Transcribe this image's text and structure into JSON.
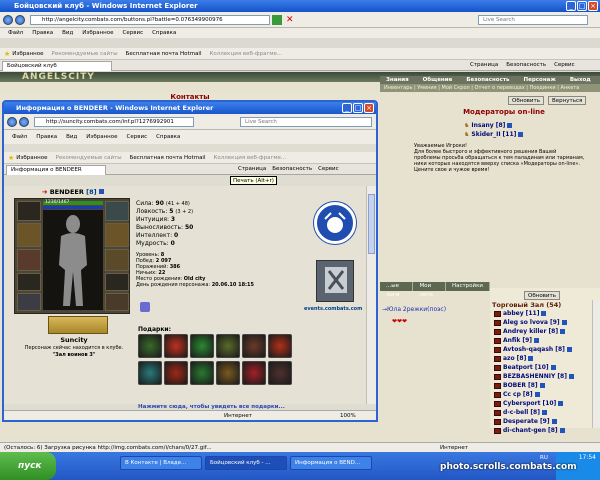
{
  "main_window": {
    "title": "Бойцовский клуб - Windows Internet Explorer",
    "url": "http://angelcity.combats.com/buttons.pl?battle=0.076349900976",
    "search_placeholder": "Live Search"
  },
  "menu": [
    "Файл",
    "Правка",
    "Вид",
    "Избранное",
    "Сервис",
    "Справка"
  ],
  "favorites": {
    "label": "Избранное",
    "items": [
      "Рекомендуемые сайты",
      "Бесплатная почта Hotmail",
      "Коллекция веб-фрагме..."
    ]
  },
  "tab": {
    "label": "Бойцовский клуб"
  },
  "tab_tools": [
    "Страница",
    "Безопасность",
    "Сервис"
  ],
  "game": {
    "banner": "ANGELSCITY",
    "nav": [
      "Знания",
      "Общение",
      "Безопасность",
      "Персонаж",
      "Выход"
    ],
    "subnav": "Инвентарь | Умения | Мой Скрол | Отчет о переводах | Поединки | Анкета",
    "contacts_title": "Контакты",
    "refresh_btn": "Обновить",
    "back_btn": "Вернуться",
    "moderators": {
      "title": "Модераторы on-line",
      "list": [
        {
          "name": "Insany",
          "level": "[8]"
        },
        {
          "name": "Skider_II",
          "level": "[11]"
        }
      ],
      "text": [
        "Уважаемые Игроки!",
        "Для более быстрого и эффективного решения Вашей",
        "проблемы просьба обращаться к тем паладинам или тарманам,",
        "ники которых находятся вверху списка «Модераторы on-line».",
        "Цените свое и чужое время!"
      ]
    },
    "bottom_tabs": [
      "...ые логи",
      "Мои логи",
      "Настройки"
    ],
    "room": {
      "refresh": "Обновить",
      "title": "Торговый Зал (54)",
      "players": [
        {
          "name": "abbey",
          "level": "[11]"
        },
        {
          "name": "Aleg so lvova",
          "level": "[9]"
        },
        {
          "name": "Andrey killer",
          "level": "[8]"
        },
        {
          "name": "Anfik",
          "level": "[9]"
        },
        {
          "name": "Avtosh-qaqash",
          "level": "[8]"
        },
        {
          "name": "azo",
          "level": "[8]"
        },
        {
          "name": "Beatport",
          "level": "[10]"
        },
        {
          "name": "BEZBASHENNIY",
          "level": "[8]"
        },
        {
          "name": "BOBER",
          "level": "[8]"
        },
        {
          "name": "Cc cp",
          "level": "[8]"
        },
        {
          "name": "Cybersport",
          "level": "[10]"
        },
        {
          "name": "d-c-bell",
          "level": "[8]"
        },
        {
          "name": "Desperate",
          "level": "[9]"
        },
        {
          "name": "di-chant-gen",
          "level": "[8]"
        }
      ]
    },
    "chat": "Юла 2режки(поэс)"
  },
  "popup": {
    "title": "Информация о BENDEER - Windows Internet Explorer",
    "url": "http://suncity.combats.com/inf.pl?1276992901",
    "search_placeholder": "Live Search",
    "tab_label": "Информация о BENDEER",
    "tooltip": "Печать (Alt+r)",
    "character": {
      "name": "BENDEER",
      "level": "[8]",
      "hp": "1230/1467",
      "mana": "0/0",
      "stats": [
        {
          "label": "Сила:",
          "value": "90",
          "extra": "(41 + 48)"
        },
        {
          "label": "Ловкость:",
          "value": "5",
          "extra": "(3 + 2)"
        },
        {
          "label": "Интуиция:",
          "value": "3",
          "extra": ""
        },
        {
          "label": "Выносливость:",
          "value": "50",
          "extra": ""
        },
        {
          "label": "Интеллект:",
          "value": "0",
          "extra": ""
        },
        {
          "label": "Мудрость:",
          "value": "0",
          "extra": ""
        }
      ],
      "info": [
        {
          "label": "Уровень:",
          "value": "8"
        },
        {
          "label": "Побед:",
          "value": "2 097"
        },
        {
          "label": "Поражений:",
          "value": "386"
        },
        {
          "label": "Ничьих:",
          "value": "22"
        },
        {
          "label": "Место рождения:",
          "value": "Old city"
        },
        {
          "label": "День рождения персонажа:",
          "value": "20.06.10 18:15"
        }
      ],
      "city": "Suncity",
      "location": "Персонаж сейчас находится в клубе.",
      "room": "\"Зал воинов 3\"",
      "gifts_label": "Подарки:",
      "gifts_link": "Нажмите сюда, чтобы увидеть все подарки...",
      "site": "events.combats.com"
    },
    "status": "Интернет",
    "zoom": "100%"
  },
  "statusbar": {
    "text": "(Осталось: 6) Загрузка рисунка http://img.combats.com/i/chars/0/27.gif...",
    "zone": "Интернет"
  },
  "taskbar": {
    "start": "пуск",
    "buttons": [
      "В Контакте | Владе...",
      "Бойцовский клуб - ...",
      "Информация о BEND..."
    ],
    "clock": "17:54",
    "lang": "RU"
  },
  "watermark": "photo.scrolls.combats.com",
  "colors": {
    "title_blue": "#1756cc",
    "game_red": "#8b0000",
    "nick_blue": "#000b7a",
    "xp_green": "#2f8f23"
  }
}
